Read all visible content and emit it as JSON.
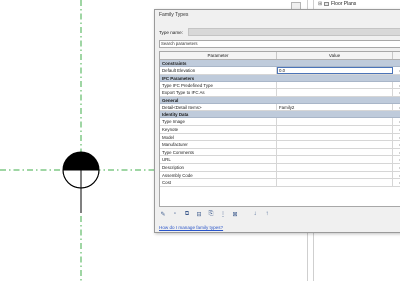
{
  "browser": {
    "item_label": "Floor Plans"
  },
  "dialog": {
    "title": "Family Types",
    "type_name_label": "Type name:",
    "type_name_value": "",
    "search_placeholder": "Search parameters",
    "columns": [
      "Parameter",
      "Value",
      ""
    ],
    "groups": [
      {
        "name": "Constraints",
        "rows": [
          {
            "param": "Default Elevation",
            "value": "0.0",
            "extra": "=",
            "editing": true
          }
        ]
      },
      {
        "name": "IFC Parameters",
        "rows": [
          {
            "param": "Type IFC Predefined Type",
            "value": "",
            "extra": "="
          },
          {
            "param": "Export Type to IFC As",
            "value": "",
            "extra": "="
          }
        ]
      },
      {
        "name": "General",
        "rows": [
          {
            "param": "Detail<Detail Items>",
            "value": "Family2",
            "extra": "="
          }
        ]
      },
      {
        "name": "Identity Data",
        "rows": [
          {
            "param": "Type Image",
            "value": "",
            "extra": "="
          },
          {
            "param": "Keynote",
            "value": "",
            "extra": "="
          },
          {
            "param": "Model",
            "value": "",
            "extra": "="
          },
          {
            "param": "Manufacturer",
            "value": "",
            "extra": "="
          },
          {
            "param": "Type Comments",
            "value": "",
            "extra": "="
          },
          {
            "param": "URL",
            "value": "",
            "extra": "="
          },
          {
            "param": "Description",
            "value": "",
            "extra": "="
          },
          {
            "param": "Assembly Code",
            "value": "",
            "extra": "="
          },
          {
            "param": "Cost",
            "value": "",
            "extra": "="
          }
        ]
      }
    ],
    "toolbar": [
      {
        "name": "edit-type-icon",
        "glyph": "✎"
      },
      {
        "name": "new-type-icon",
        "glyph": "▫"
      },
      {
        "name": "rename-type-icon",
        "glyph": "⧉"
      },
      {
        "name": "delete-type-icon",
        "glyph": "⊟"
      },
      {
        "name": "new-parameter-icon",
        "glyph": "⎘"
      },
      {
        "name": "modify-parameter-icon",
        "glyph": "⋮"
      },
      {
        "name": "delete-parameter-icon",
        "glyph": "⊠"
      },
      {
        "name": "move-up-icon",
        "glyph": "↓"
      },
      {
        "name": "move-down-icon",
        "glyph": "↑"
      }
    ],
    "help_link": "How do I manage family types?"
  },
  "colors": {
    "ref_plane": "#3fae4a",
    "group_header": "#bfcbdb",
    "link": "#2a55c9"
  }
}
